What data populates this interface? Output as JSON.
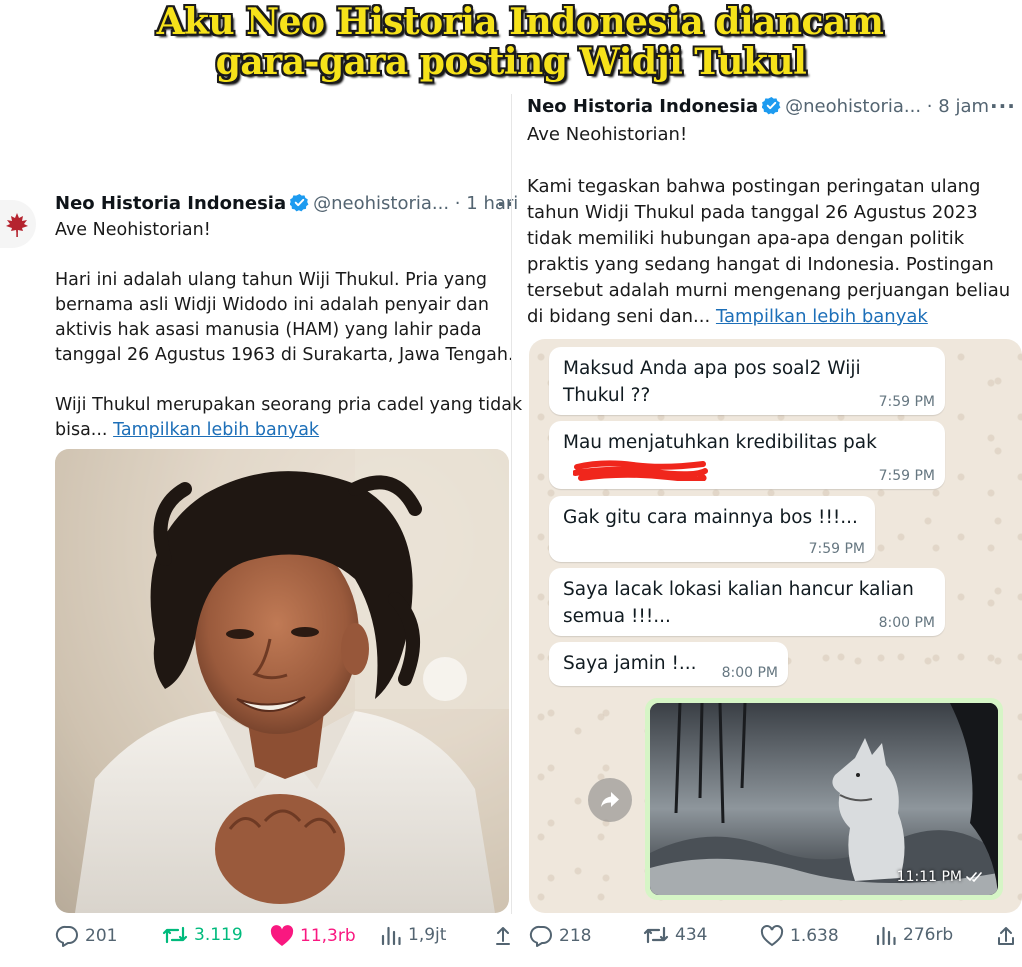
{
  "headline": {
    "line1": "Aku Neo Historia Indonesia diancam",
    "line2": "gara-gara posting Widji Tukul",
    "color": "#f6e21a"
  },
  "left_tweet": {
    "name": "Neo Historia Indonesia",
    "handle": "@neohistoria...",
    "dot": "·",
    "time": "1 hari",
    "more": "··",
    "greeting": "Ave Neohistorian!",
    "paragraph1": [
      "Hari ini adalah ulang tahun Wiji Thukul. Pria yang",
      "bernama asli Widji Widodo ini adalah penyair dan",
      "aktivis hak asasi manusia (HAM) yang lahir pada",
      "tanggal 26 Agustus 1963 di Surakarta, Jawa Tengah."
    ],
    "paragraph2_line1": "Wiji Thukul merupakan seorang pria cadel yang tidak",
    "paragraph2_line2": "bisa...",
    "show_more": "Tampilkan lebih banyak",
    "actions": {
      "replies": "201",
      "reposts": "3.119",
      "likes": "11,3rb",
      "views": "1,9jt"
    },
    "repost_color": "#00ba7c",
    "like_color": "#f91880"
  },
  "right_tweet": {
    "name": "Neo Historia Indonesia",
    "handle": "@neohistoria...",
    "dot": "·",
    "time": "8 jam",
    "more": "···",
    "greeting": "Ave Neohistorian!",
    "paragraph": [
      "Kami tegaskan bahwa postingan peringatan ulang",
      "tahun Widji Thukul pada tanggal 26 Agustus 2023",
      "tidak memiliki hubungan apa-apa dengan politik",
      "praktis yang sedang hangat di Indonesia. Postingan",
      "tersebut adalah murni mengenang perjuangan beliau"
    ],
    "last_line": "di bidang seni dan...",
    "show_more": "Tampilkan lebih banyak",
    "actions": {
      "replies": "218",
      "reposts": "434",
      "likes": "1.638",
      "views": "276rb"
    }
  },
  "chat": {
    "messages": [
      {
        "lines": [
          "Maksud Anda apa pos soal2 Wiji",
          "Thukul ??"
        ],
        "time": "7:59 PM"
      },
      {
        "lines": [
          "Mau menjatuhkan kredibilitas pak"
        ],
        "time": "7:59 PM"
      },
      {
        "lines": [
          "Gak gitu cara mainnya bos !!!..."
        ],
        "time": "7:59 PM"
      },
      {
        "lines": [
          "Saya lacak lokasi kalian hancur kalian",
          "semua !!!..."
        ],
        "time": "8:00 PM"
      },
      {
        "lines": [
          "Saya jamin !..."
        ],
        "time": "8:00 PM"
      }
    ],
    "image_time": "11:11 PM",
    "forward_icon": "forward-icon",
    "outgoing_color": "#d6f5c6"
  },
  "brand_color": "#b5232e",
  "link_color": "#1d6fb8"
}
